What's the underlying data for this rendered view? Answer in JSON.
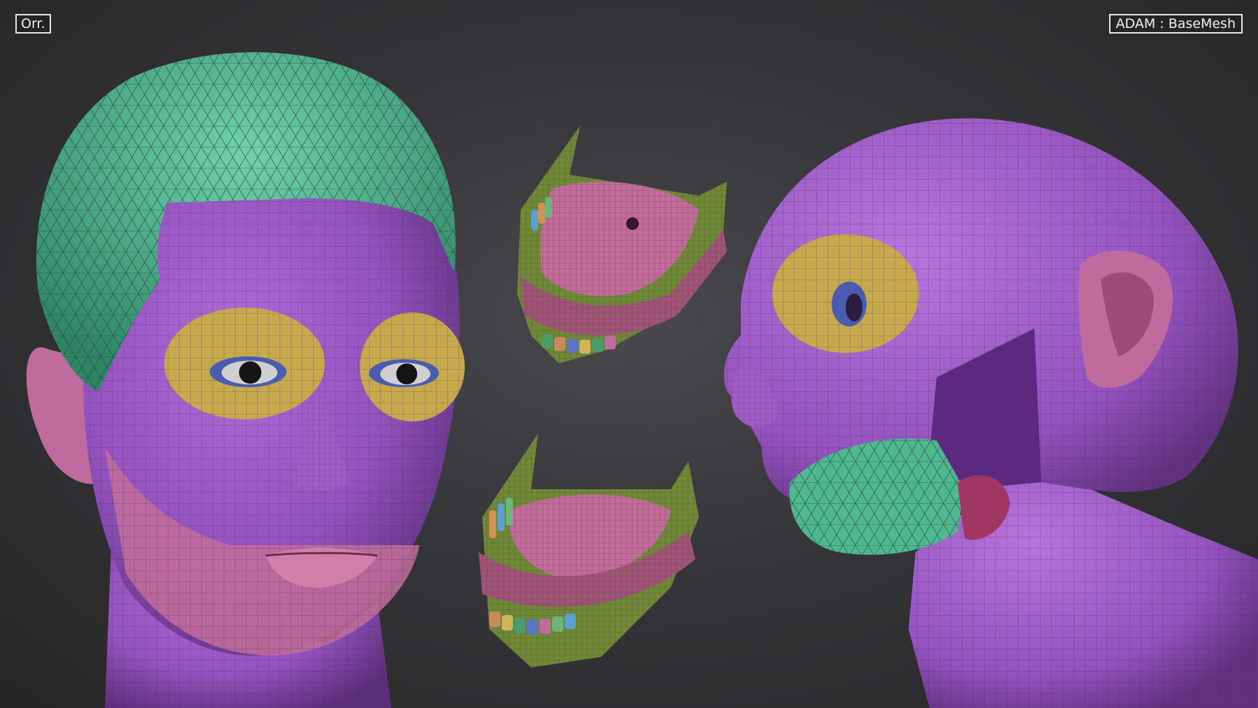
{
  "viewport": {
    "view_label": "Orr.",
    "mesh_label": "ADAM : BaseMesh"
  },
  "colors": {
    "background": "#2e2e31",
    "skin_purple": "#9a55c4",
    "hair_green": "#4fb891",
    "eye_yellow": "#c6a94a",
    "lip_pink": "#c36f9a",
    "gum_pink": "#b0607f",
    "gum_olive": "#6f8a34",
    "eye_blue": "#4a5bb0",
    "wireframe": "#3c1f52"
  },
  "models": [
    {
      "name": "head-front-view"
    },
    {
      "name": "mouth-upper-view"
    },
    {
      "name": "mouth-lower-view"
    },
    {
      "name": "head-side-view"
    }
  ]
}
